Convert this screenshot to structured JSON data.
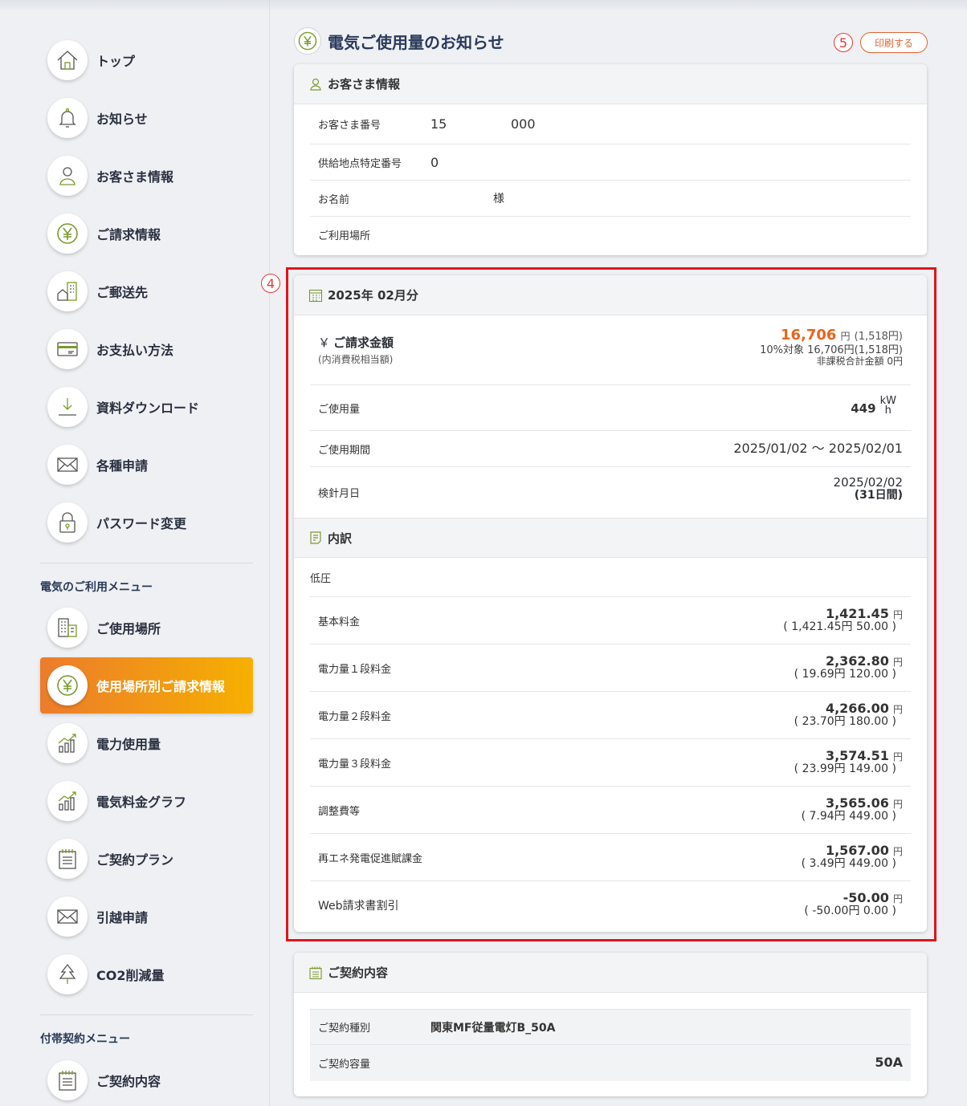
{
  "sidebar": {
    "items": [
      {
        "label": "トップ",
        "icon": "home-icon"
      },
      {
        "label": "お知らせ",
        "icon": "bell-icon"
      },
      {
        "label": "お客さま情報",
        "icon": "user-icon"
      },
      {
        "label": "ご請求情報",
        "icon": "yen-icon"
      },
      {
        "label": "ご郵送先",
        "icon": "building-home-icon"
      },
      {
        "label": "お支払い方法",
        "icon": "credit-card-icon"
      },
      {
        "label": "資料ダウンロード",
        "icon": "download-icon"
      },
      {
        "label": "各種申請",
        "icon": "envelope-icon"
      },
      {
        "label": "パスワード変更",
        "icon": "lock-icon"
      }
    ],
    "section_electric": "電気のご利用メニュー",
    "electric_items": [
      {
        "label": "ご使用場所",
        "icon": "building-icon"
      },
      {
        "label": "使用場所別ご請求情報",
        "icon": "yen-icon",
        "active": true
      },
      {
        "label": "電力使用量",
        "icon": "bar-chart-icon"
      },
      {
        "label": "電気料金グラフ",
        "icon": "bar-chart-icon"
      },
      {
        "label": "ご契約プラン",
        "icon": "notepad-icon"
      },
      {
        "label": "引越申請",
        "icon": "envelope-icon"
      },
      {
        "label": "CO2削減量",
        "icon": "tree-icon"
      }
    ],
    "section_additional": "付帯契約メニュー",
    "additional_items": [
      {
        "label": "ご契約内容",
        "icon": "notepad-icon"
      }
    ]
  },
  "header": {
    "title": "電気ご使用量のお知らせ",
    "marker5": "5",
    "marker4": "4",
    "print_label": "印刷する"
  },
  "customer": {
    "heading": "お客さま情報",
    "number_label": "お客さま番号",
    "number_a": "15",
    "number_b": "000",
    "supply_label": "供給地点特定番号",
    "supply_value": "0",
    "name_label": "お名前",
    "name_suffix": "様",
    "location_label": "ご利用場所"
  },
  "billing": {
    "heading": "2025年 02月分",
    "amount_label": "ご請求金額",
    "yen_symbol": "￥",
    "tax_note": "(内消費税相当額)",
    "amount": "16,706",
    "amount_unit": "円",
    "amount_tax": "(1,518円)",
    "taxable_line": "10%対象 16,706円(1,518円)",
    "nontax_line": "非課税合計金額 0円",
    "usage_label": "ご使用量",
    "usage_value": "449",
    "usage_unit_top": "kW",
    "usage_unit_bottom": "h",
    "period_label": "ご使用期間",
    "period_value": "2025/01/02 ～ 2025/02/01",
    "meter_label": "検針月日",
    "meter_value": "2025/02/02",
    "meter_days": "(31日間)",
    "breakdown_heading": "内訳",
    "category": "低圧",
    "items": [
      {
        "label": "基本料金",
        "amount": "1,421.45",
        "detail": "( 1,421.45円 50.00 )"
      },
      {
        "label": "電力量１段料金",
        "amount": "2,362.80",
        "detail": "( 19.69円 120.00 )"
      },
      {
        "label": "電力量２段料金",
        "amount": "4,266.00",
        "detail": "( 23.70円 180.00 )"
      },
      {
        "label": "電力量３段料金",
        "amount": "3,574.51",
        "detail": "( 23.99円 149.00 )"
      },
      {
        "label": "調整費等",
        "amount": "3,565.06",
        "detail": "( 7.94円 449.00 )"
      },
      {
        "label": "再エネ発電促進賦課金",
        "amount": "1,567.00",
        "detail": "( 3.49円 449.00 )"
      },
      {
        "label": "Web請求書割引",
        "amount": "-50.00",
        "detail": "( -50.00円 0.00 )"
      }
    ],
    "item_unit": "円"
  },
  "contract": {
    "heading": "ご契約内容",
    "type_label": "ご契約種別",
    "type_value": "関東MF従量電灯B_50A",
    "capacity_label": "ご契約容量",
    "capacity_value": "50A"
  },
  "colors": {
    "accent_orange": "#ec7c2c",
    "icon_green": "#7a9a2e",
    "red_frame": "#e0151c",
    "link_blue": "#1668b2"
  }
}
